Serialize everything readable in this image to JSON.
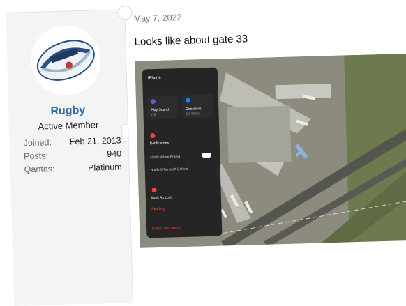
{
  "user": {
    "name": "Rugby",
    "title": "Active Member",
    "stats": [
      {
        "label": "Joined:",
        "value": "Feb 21, 2013"
      },
      {
        "label": "Posts:",
        "value": "940"
      },
      {
        "label": "Qantas:",
        "value": "Platinum"
      }
    ]
  },
  "post": {
    "date": "May 7, 2022",
    "message": "Looks like about gate 33"
  },
  "screenshot": {
    "device": "iPhone",
    "tiles": [
      "Play Sound",
      "Directions"
    ],
    "tile_subs": [
      "Off",
      "2,344 km"
    ],
    "notifications": "Notifications",
    "notify_found": "Notify When Found",
    "notify_left": "Notify When Left Behind",
    "mark_lost": "Mark As Lost",
    "pending": "Pending",
    "erase": "Erase This Device"
  },
  "colors": {
    "username": "#2f6ba8",
    "sidebar": "#f4f4f5",
    "ios_blue": "#0a84ff",
    "ios_red": "#ff453a"
  }
}
